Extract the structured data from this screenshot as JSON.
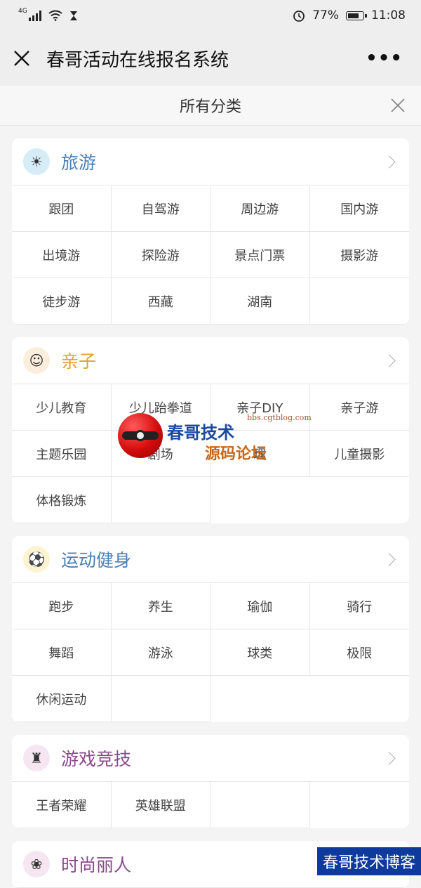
{
  "status": {
    "network": "4G",
    "battery": "77%",
    "battery_level": 0.77,
    "time": "11:08"
  },
  "header": {
    "title": "春哥活动在线报名系统",
    "more": "•••"
  },
  "category_bar": {
    "title": "所有分类"
  },
  "colors": {
    "travel": "#4a7fb5",
    "family": "#e0a030",
    "sport": "#4a7fb5",
    "game": "#8a4a8a",
    "fashion": "#8a4a8a"
  },
  "sections": [
    {
      "name": "旅游",
      "icon": "beach-icon",
      "items": [
        "跟团",
        "自驾游",
        "周边游",
        "国内游",
        "出境游",
        "探险游",
        "景点门票",
        "摄影游",
        "徒步游",
        "西藏",
        "湖南"
      ]
    },
    {
      "name": "亲子",
      "icon": "family-icon",
      "items": [
        "少儿教育",
        "少儿跆拳道",
        "亲子DIY",
        "亲子游",
        "主题乐园",
        "剧场",
        "理",
        "儿童摄影",
        "体格锻炼"
      ]
    },
    {
      "name": "运动健身",
      "icon": "ball-icon",
      "items": [
        "跑步",
        "养生",
        "瑜伽",
        "骑行",
        "舞蹈",
        "游泳",
        "球类",
        "极限",
        "休闲运动"
      ]
    },
    {
      "name": "游戏竞技",
      "icon": "game-icon",
      "items": [
        "王者荣耀",
        "英雄联盟"
      ]
    },
    {
      "name": "时尚丽人",
      "icon": "fashion-icon",
      "items": []
    }
  ],
  "watermark": {
    "line1": "春哥技术",
    "url": "bbs.cgtblog.com",
    "line2": "源码论坛",
    "corner": "春哥技术博客"
  }
}
